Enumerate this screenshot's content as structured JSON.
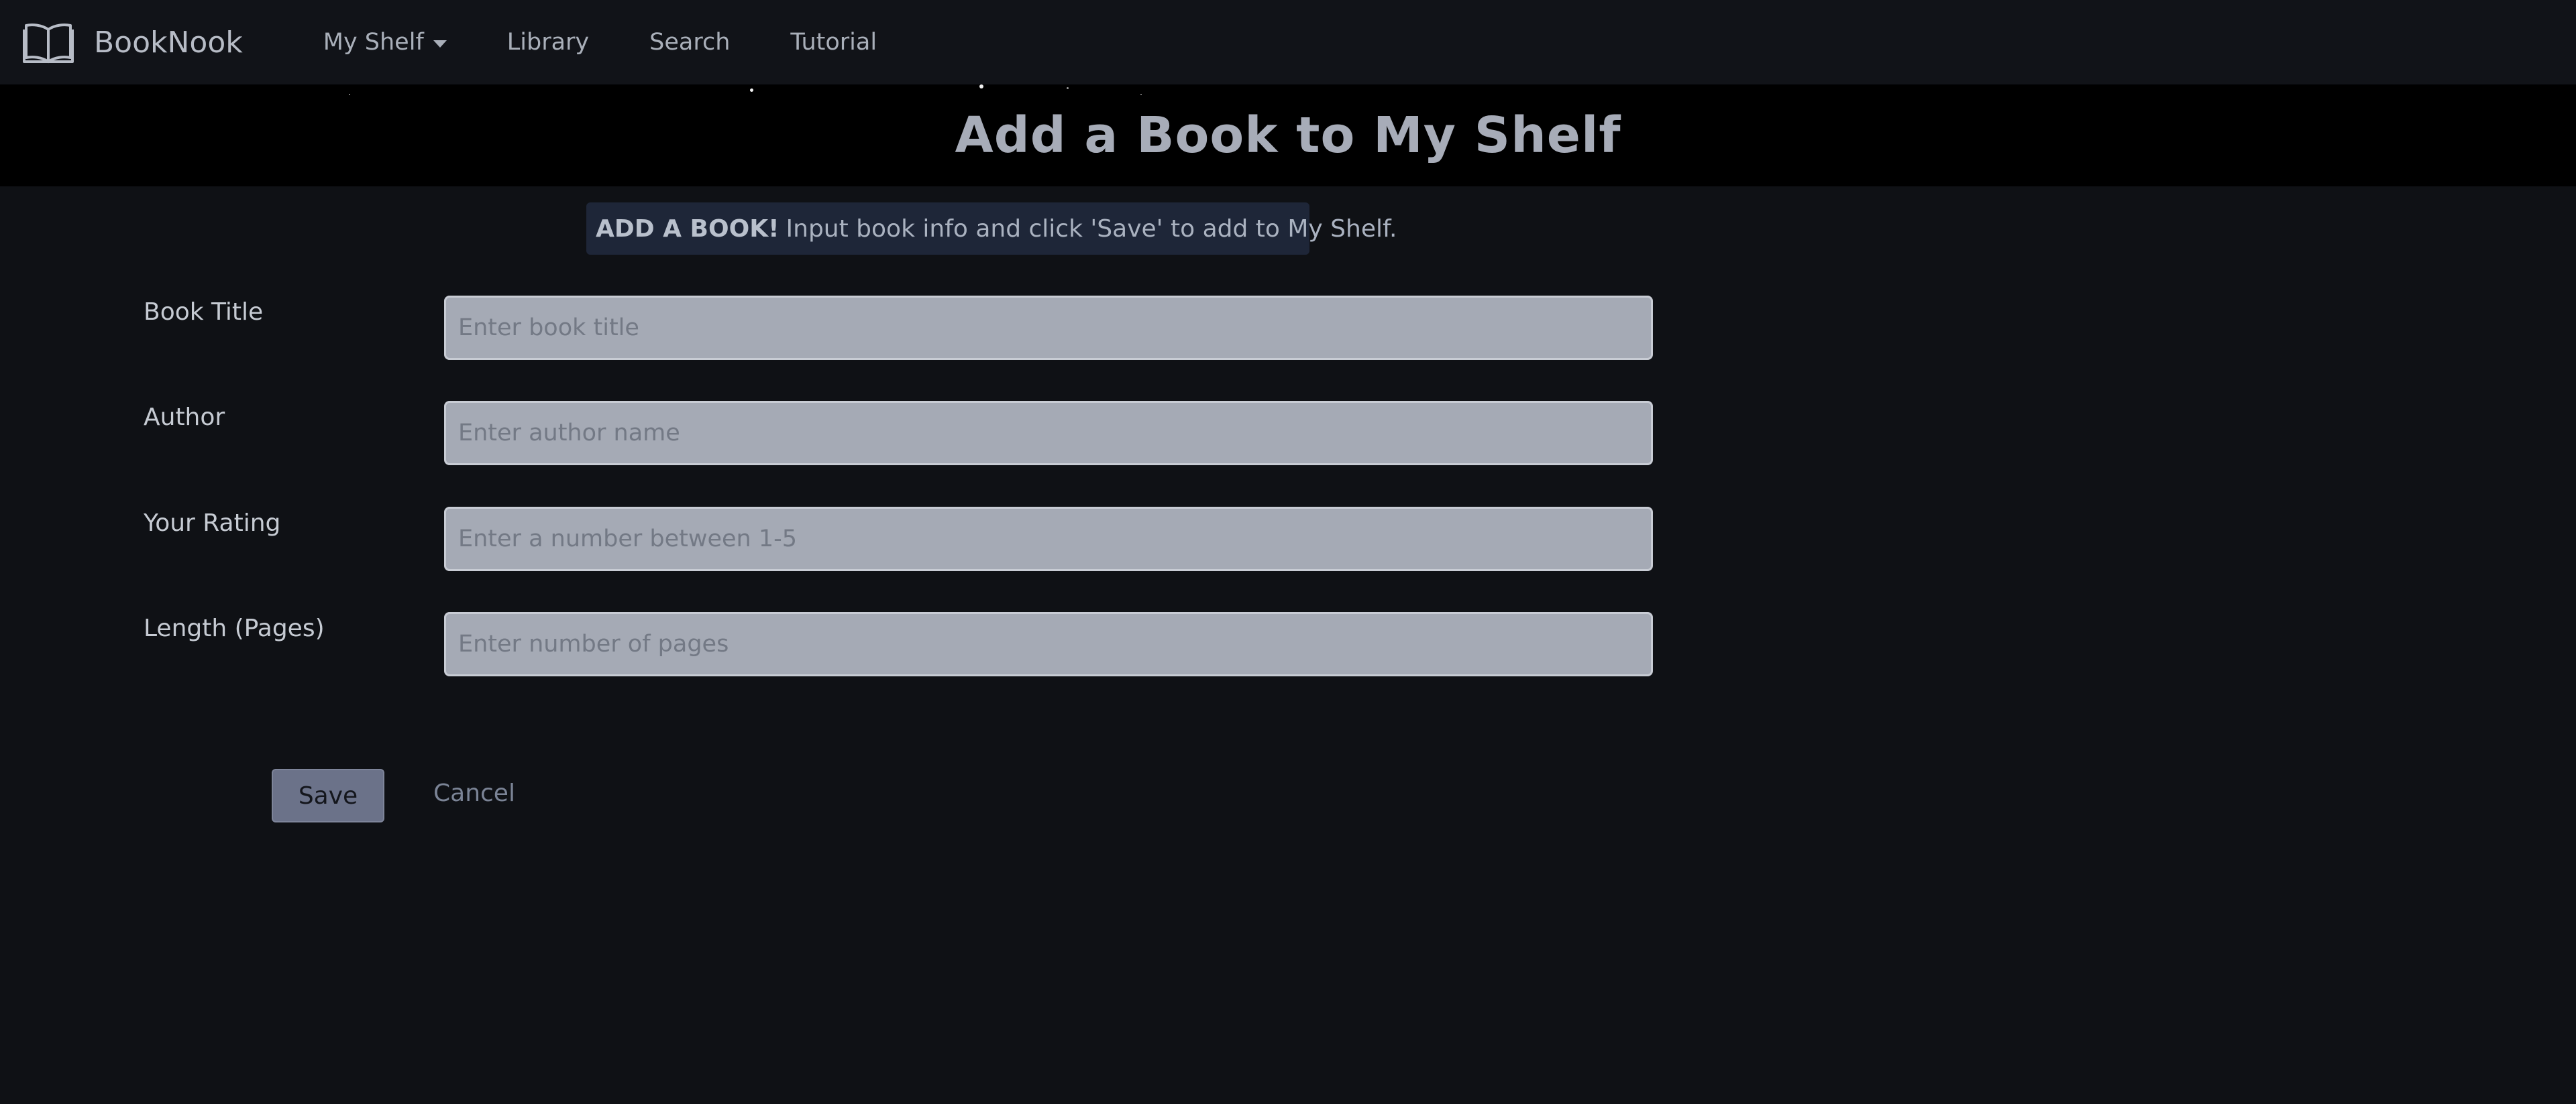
{
  "app": {
    "brand_name": "BookNook",
    "brand_icon": "open-book-icon"
  },
  "nav": {
    "items": [
      {
        "label": "My Shelf",
        "has_dropdown": true
      },
      {
        "label": "Library",
        "has_dropdown": false
      },
      {
        "label": "Search",
        "has_dropdown": false
      },
      {
        "label": "Tutorial",
        "has_dropdown": false
      }
    ]
  },
  "hero": {
    "title": "Add a Book to My Shelf"
  },
  "alert": {
    "strong": "ADD A BOOK!",
    "text": "Input book info and click 'Save' to add to My Shelf."
  },
  "form": {
    "fields": [
      {
        "label": "Book Title",
        "value": "",
        "placeholder": "Enter book title"
      },
      {
        "label": "Author",
        "value": "",
        "placeholder": "Enter author name"
      },
      {
        "label": "Your Rating",
        "value": "",
        "placeholder": "Enter a number between 1-5"
      },
      {
        "label": "Length (Pages)",
        "value": "",
        "placeholder": "Enter number of pages"
      }
    ],
    "save_label": "Save",
    "cancel_label": "Cancel"
  },
  "colors": {
    "page_bg": "#0f1115",
    "navbar_bg": "#111318",
    "hero_bg": "#000000",
    "alert_bg": "#1e2638",
    "input_bg": "#a5aab5",
    "save_button_bg": "#6b7289"
  }
}
